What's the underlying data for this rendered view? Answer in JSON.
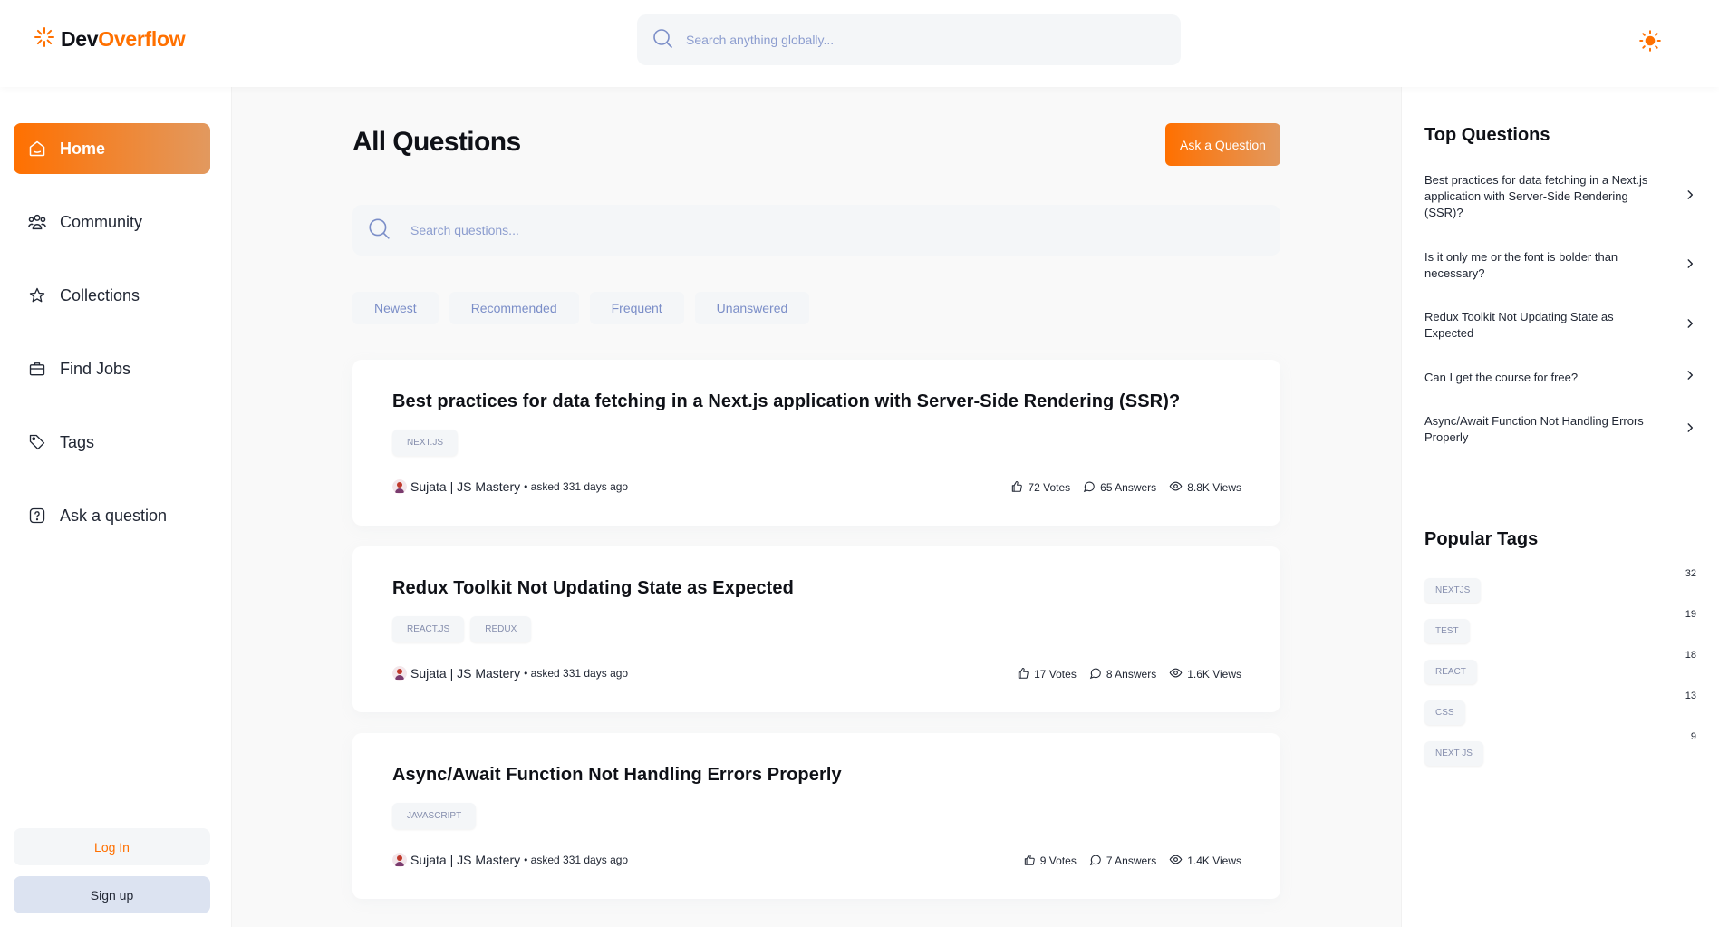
{
  "header": {
    "logo_dev": "Dev",
    "logo_overflow": "Overflow",
    "search_placeholder": "Search anything globally..."
  },
  "sidebar": {
    "items": [
      {
        "label": "Home",
        "icon": "home-icon",
        "active": true
      },
      {
        "label": "Community",
        "icon": "users-icon",
        "active": false
      },
      {
        "label": "Collections",
        "icon": "star-icon",
        "active": false
      },
      {
        "label": "Find Jobs",
        "icon": "suitcase-icon",
        "active": false
      },
      {
        "label": "Tags",
        "icon": "tag-icon",
        "active": false
      },
      {
        "label": "Ask a question",
        "icon": "question-icon",
        "active": false
      }
    ],
    "login_label": "Log In",
    "signup_label": "Sign up"
  },
  "main": {
    "title": "All Questions",
    "ask_button": "Ask a Question",
    "search_placeholder": "Search questions...",
    "filters": [
      "Newest",
      "Recommended",
      "Frequent",
      "Unanswered"
    ],
    "questions": [
      {
        "title": "Best practices for data fetching in a Next.js application with Server-Side Rendering (SSR)?",
        "tags": [
          "NEXT.JS"
        ],
        "author": "Sujata | JS Mastery",
        "meta": "• asked 331 days ago",
        "votes": "72 Votes",
        "answers": "65 Answers",
        "views": "8.8K Views"
      },
      {
        "title": "Redux Toolkit Not Updating State as Expected",
        "tags": [
          "REACT.JS",
          "REDUX"
        ],
        "author": "Sujata | JS Mastery",
        "meta": "• asked 331 days ago",
        "votes": "17 Votes",
        "answers": "8 Answers",
        "views": "1.6K Views"
      },
      {
        "title": "Async/Await Function Not Handling Errors Properly",
        "tags": [
          "JAVASCRIPT"
        ],
        "author": "Sujata | JS Mastery",
        "meta": "• asked 331 days ago",
        "votes": "9 Votes",
        "answers": "7 Answers",
        "views": "1.4K Views"
      }
    ]
  },
  "right_sidebar": {
    "top_questions_title": "Top Questions",
    "top_questions": [
      "Best practices for data fetching in a Next.js application with Server-Side Rendering (SSR)?",
      "Is it only me or the font is bolder than necessary?",
      "Redux Toolkit Not Updating State as Expected",
      "Can I get the course for free?",
      "Async/Await Function Not Handling Errors Properly"
    ],
    "popular_tags_title": "Popular Tags",
    "popular_tags": [
      {
        "name": "NEXTJS",
        "count": "32"
      },
      {
        "name": "TEST",
        "count": "19"
      },
      {
        "name": "REACT",
        "count": "18"
      },
      {
        "name": "CSS",
        "count": "13"
      },
      {
        "name": "NEXT JS",
        "count": "9"
      }
    ]
  },
  "colors": {
    "accent": "#ff7000",
    "accent_light": "#e2995f",
    "muted_blue": "#7b8ec8"
  }
}
